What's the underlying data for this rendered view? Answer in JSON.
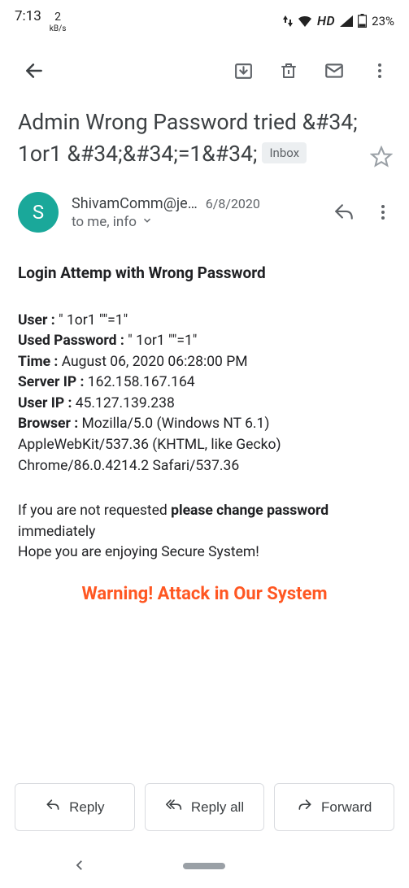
{
  "status": {
    "time": "7:13",
    "net_speed_value": "2",
    "net_speed_unit": "kB/s",
    "hd": "HD",
    "battery": "23%"
  },
  "subject": {
    "text": "Admin Wrong Password tried &#34; 1or1 &#34;&#34;=1&#34;",
    "label": "Inbox"
  },
  "sender": {
    "initial": "S",
    "name": "ShivamComm@je…",
    "date": "6/8/2020",
    "recipients": "to me, info"
  },
  "email_body": {
    "heading": "Login Attemp with Wrong Password",
    "user_label": "User :",
    "user_value": " \" 1or1 \"\"=1\"",
    "password_label": "Used Password :",
    "password_value": " \" 1or1 \"\"=1\"",
    "time_label": "Time :",
    "time_value": " August 06, 2020 06:28:00 PM",
    "serverip_label": "Server IP :",
    "serverip_value": " 162.158.167.164",
    "userip_label": "User IP :",
    "userip_value": " 45.127.139.238",
    "browser_label": "Browser :",
    "browser_value": " Mozilla/5.0 (Windows NT 6.1) AppleWebKit/537.36 (KHTML, like Gecko) Chrome/86.0.4214.2 Safari/537.36",
    "note_prefix": "If you are not requested ",
    "note_bold": "please change password",
    "note_suffix1": " immediately",
    "note_suffix2": "Hope you are enjoying Secure System!",
    "warning": "Warning! Attack in Our System"
  },
  "actions": {
    "reply": "Reply",
    "reply_all": "Reply all",
    "forward": "Forward"
  }
}
